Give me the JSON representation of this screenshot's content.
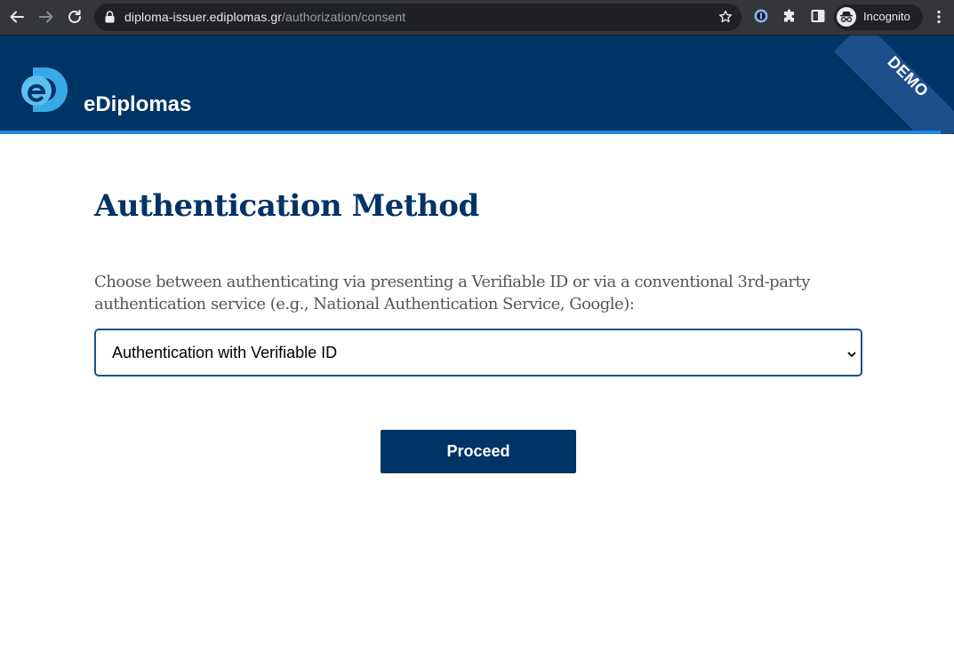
{
  "browser": {
    "url_host": "diploma-issuer.ediplomas.gr",
    "url_path": "/authorization/consent",
    "incognito_label": "Incognito",
    "icons": [
      "back-icon",
      "forward-icon",
      "reload-icon",
      "lock-icon",
      "star-icon",
      "password-manager-icon",
      "extensions-icon",
      "side-panel-icon",
      "incognito-icon",
      "menu-icon"
    ]
  },
  "header": {
    "brand": "eDiplomas",
    "logo_letter": "e",
    "ribbon": "DEMO",
    "colors": {
      "background": "#003366",
      "accent": "#1e88e5",
      "logo": "#39a9e6"
    }
  },
  "main": {
    "title": "Authentication Method",
    "description": "Choose between authenticating via presenting a Verifiable ID or via a conventional 3rd-party authentication service (e.g., National Authentication Service, Google):",
    "select": {
      "value": "Authentication with Verifiable ID"
    },
    "proceed_label": "Proceed"
  }
}
